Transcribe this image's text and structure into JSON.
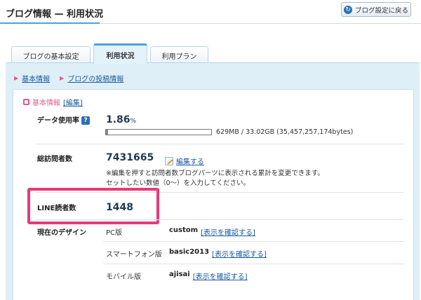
{
  "header": {
    "title": "ブログ情報 — 利用状況",
    "back_button": "ブログ設定に戻る"
  },
  "tabs": [
    {
      "label": "ブログの基本設定",
      "active": false
    },
    {
      "label": "利用状況",
      "active": true
    },
    {
      "label": "利用プラン",
      "active": false
    }
  ],
  "breadcrumb": [
    "基本情報",
    "ブログの投稿情報"
  ],
  "section": {
    "title": "基本情報",
    "edit_link": "[編集]"
  },
  "data_usage": {
    "label": "データ使用率",
    "help": "?",
    "percent": "1.86",
    "unit": "%",
    "fill_fraction": 0.0186,
    "caption": "629MB / 33.02GB (35,457,257,174bytes)"
  },
  "visitors": {
    "label": "総訪問者数",
    "value": "7431665",
    "edit_label": "編集する",
    "note_line1": "※編集を押すと訪問者数ブログパーツに表示される累計を変更できます。",
    "note_line2": "セットしたい数値（0〜）を入力してください。"
  },
  "line_readers": {
    "label": "LINE読者数",
    "value": "1448"
  },
  "design": {
    "label": "現在のデザイン",
    "rows": [
      {
        "device": "PC版",
        "theme": "custom",
        "link": "[表示を確認する]"
      },
      {
        "device": "スマートフォン版",
        "theme": "basic2013",
        "link": "[表示を確認する]"
      },
      {
        "device": "モバイル版",
        "theme": "ajisai",
        "link": "[表示を確認する]"
      }
    ]
  },
  "colors": {
    "accent": "#4aa3d8",
    "highlight": "#e8397a",
    "link": "#1a5aa0",
    "pink": "#e05a8c"
  }
}
